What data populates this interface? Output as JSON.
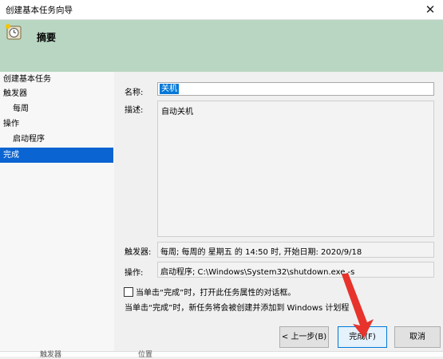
{
  "window": {
    "title": "创建基本任务向导",
    "close_glyph": "✕"
  },
  "banner": {
    "heading": "摘要"
  },
  "steps": [
    {
      "label": "创建基本任务",
      "level": "top",
      "active": false
    },
    {
      "label": "触发器",
      "level": "top",
      "active": false
    },
    {
      "label": "每周",
      "level": "sub",
      "active": false
    },
    {
      "label": "操作",
      "level": "top",
      "active": false
    },
    {
      "label": "启动程序",
      "level": "sub",
      "active": false
    },
    {
      "label": "完成",
      "level": "top",
      "active": true
    }
  ],
  "form": {
    "name_label": "名称:",
    "name_value": "关机",
    "desc_label": "描述:",
    "desc_value": "自动关机",
    "trigger_label": "触发器:",
    "trigger_value": "每周; 每周的 星期五 的 14:50 时, 开始日期: 2020/9/18",
    "action_label": "操作:",
    "action_value": "启动程序; C:\\Windows\\System32\\shutdown.exe -s"
  },
  "checkbox": {
    "label": "当单击“完成”时，打开此任务属性的对话框。",
    "checked": false
  },
  "note": "当单击“完成”时，新任务将会被创建并添加到 Windows 计划程",
  "buttons": {
    "back": "< 上一步(B)",
    "finish": "完成(F)",
    "cancel": "取消"
  },
  "background_strip": {
    "text1": "触发器",
    "text2": "位置"
  },
  "colors": {
    "banner": "#b8d6c2",
    "active_step": "#0a64d2",
    "selection": "#0078d7",
    "annotation_arrow": "#e8322c"
  }
}
